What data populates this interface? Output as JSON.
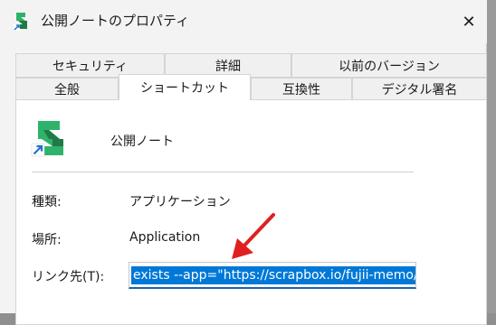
{
  "window": {
    "title": "公開ノートのプロパティ",
    "close_glyph": "✕"
  },
  "tabs": {
    "top_row": [
      {
        "label": "セキュリティ"
      },
      {
        "label": "詳細"
      },
      {
        "label": "以前のバージョン"
      }
    ],
    "bottom_row": [
      {
        "label": "全般"
      },
      {
        "label": "ショートカット",
        "active": true
      },
      {
        "label": "互換性"
      },
      {
        "label": "デジタル署名"
      }
    ]
  },
  "shortcut": {
    "name": "公開ノート",
    "type_label": "種類:",
    "type_value": "アプリケーション",
    "location_label": "場所:",
    "location_value": "Application",
    "target_label": "リンク先(T):",
    "target_value": "exists --app=\"https://scrapbox.io/fujii-memo/\""
  },
  "colors": {
    "selection": "#0078d7",
    "annotation_arrow": "#e02020",
    "icon_green": "#2fb36a",
    "icon_dark_green": "#1f7a46",
    "shortcut_arrow_blue": "#1e73c8"
  }
}
